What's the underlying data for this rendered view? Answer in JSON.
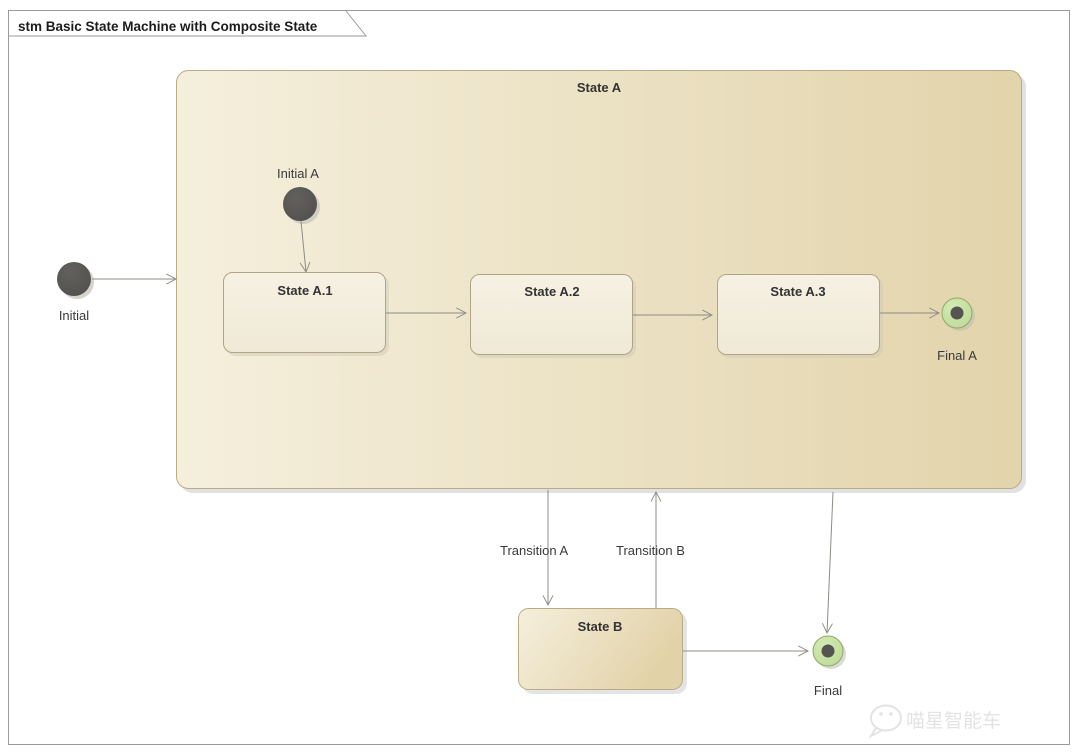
{
  "frame": {
    "title": "stm Basic State Machine with Composite State",
    "border_color": "#9a9a9a",
    "background": "#ffffff"
  },
  "diagram": {
    "type": "uml-state-machine",
    "composite_state": {
      "name": "State A",
      "fill_start": "#f5efdd",
      "fill_end": "#e2d4ab",
      "border_color": "#b9ab85",
      "substates": [
        {
          "name": "State A.1"
        },
        {
          "name": "State A.2"
        },
        {
          "name": "State A.3"
        }
      ],
      "initial_pseudostate": {
        "name": "Initial A"
      },
      "final_state": {
        "name": "Final A"
      }
    },
    "states": [
      {
        "name": "State B"
      }
    ],
    "initial_pseudostate": {
      "name": "Initial"
    },
    "final_state": {
      "name": "Final"
    },
    "transitions": [
      {
        "name": "Transition A",
        "from": "State A",
        "to": "State B"
      },
      {
        "name": "Transition B",
        "from": "State B",
        "to": "State A"
      }
    ],
    "colors": {
      "pseudostate_fill": "#565451",
      "final_outer_fill": "#c6e0a2",
      "final_inner_fill": "#565451",
      "final_border": "#8fa86a",
      "edge_stroke": "#8c8c85",
      "substate_fill": "#f2ecdc",
      "substate_border": "#b0a482"
    }
  },
  "watermark": {
    "text": "喵星智能车",
    "icon": "wechat-icon",
    "color": "#e2e2e2"
  }
}
